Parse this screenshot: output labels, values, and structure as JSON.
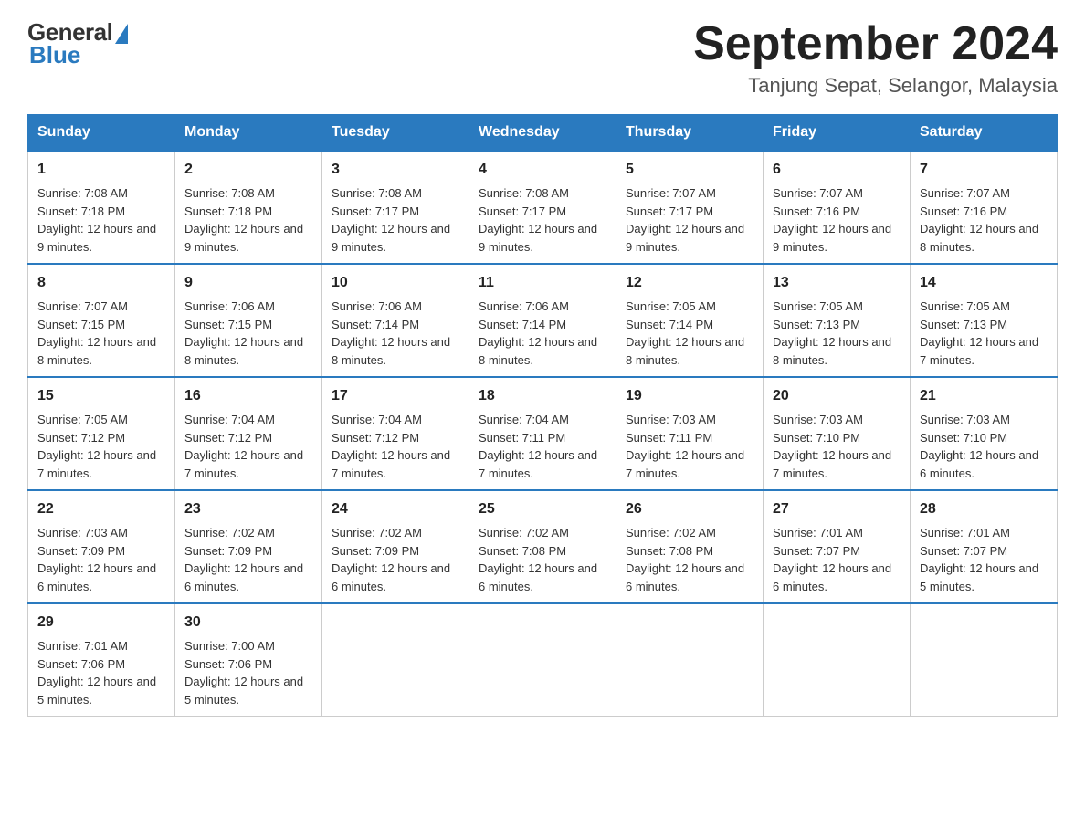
{
  "header": {
    "logo": {
      "general": "General",
      "blue": "Blue"
    },
    "title": "September 2024",
    "location": "Tanjung Sepat, Selangor, Malaysia"
  },
  "days": [
    "Sunday",
    "Monday",
    "Tuesday",
    "Wednesday",
    "Thursday",
    "Friday",
    "Saturday"
  ],
  "weeks": [
    [
      {
        "day": 1,
        "sunrise": "7:08 AM",
        "sunset": "7:18 PM",
        "daylight": "12 hours and 9 minutes."
      },
      {
        "day": 2,
        "sunrise": "7:08 AM",
        "sunset": "7:18 PM",
        "daylight": "12 hours and 9 minutes."
      },
      {
        "day": 3,
        "sunrise": "7:08 AM",
        "sunset": "7:17 PM",
        "daylight": "12 hours and 9 minutes."
      },
      {
        "day": 4,
        "sunrise": "7:08 AM",
        "sunset": "7:17 PM",
        "daylight": "12 hours and 9 minutes."
      },
      {
        "day": 5,
        "sunrise": "7:07 AM",
        "sunset": "7:17 PM",
        "daylight": "12 hours and 9 minutes."
      },
      {
        "day": 6,
        "sunrise": "7:07 AM",
        "sunset": "7:16 PM",
        "daylight": "12 hours and 9 minutes."
      },
      {
        "day": 7,
        "sunrise": "7:07 AM",
        "sunset": "7:16 PM",
        "daylight": "12 hours and 8 minutes."
      }
    ],
    [
      {
        "day": 8,
        "sunrise": "7:07 AM",
        "sunset": "7:15 PM",
        "daylight": "12 hours and 8 minutes."
      },
      {
        "day": 9,
        "sunrise": "7:06 AM",
        "sunset": "7:15 PM",
        "daylight": "12 hours and 8 minutes."
      },
      {
        "day": 10,
        "sunrise": "7:06 AM",
        "sunset": "7:14 PM",
        "daylight": "12 hours and 8 minutes."
      },
      {
        "day": 11,
        "sunrise": "7:06 AM",
        "sunset": "7:14 PM",
        "daylight": "12 hours and 8 minutes."
      },
      {
        "day": 12,
        "sunrise": "7:05 AM",
        "sunset": "7:14 PM",
        "daylight": "12 hours and 8 minutes."
      },
      {
        "day": 13,
        "sunrise": "7:05 AM",
        "sunset": "7:13 PM",
        "daylight": "12 hours and 8 minutes."
      },
      {
        "day": 14,
        "sunrise": "7:05 AM",
        "sunset": "7:13 PM",
        "daylight": "12 hours and 7 minutes."
      }
    ],
    [
      {
        "day": 15,
        "sunrise": "7:05 AM",
        "sunset": "7:12 PM",
        "daylight": "12 hours and 7 minutes."
      },
      {
        "day": 16,
        "sunrise": "7:04 AM",
        "sunset": "7:12 PM",
        "daylight": "12 hours and 7 minutes."
      },
      {
        "day": 17,
        "sunrise": "7:04 AM",
        "sunset": "7:12 PM",
        "daylight": "12 hours and 7 minutes."
      },
      {
        "day": 18,
        "sunrise": "7:04 AM",
        "sunset": "7:11 PM",
        "daylight": "12 hours and 7 minutes."
      },
      {
        "day": 19,
        "sunrise": "7:03 AM",
        "sunset": "7:11 PM",
        "daylight": "12 hours and 7 minutes."
      },
      {
        "day": 20,
        "sunrise": "7:03 AM",
        "sunset": "7:10 PM",
        "daylight": "12 hours and 7 minutes."
      },
      {
        "day": 21,
        "sunrise": "7:03 AM",
        "sunset": "7:10 PM",
        "daylight": "12 hours and 6 minutes."
      }
    ],
    [
      {
        "day": 22,
        "sunrise": "7:03 AM",
        "sunset": "7:09 PM",
        "daylight": "12 hours and 6 minutes."
      },
      {
        "day": 23,
        "sunrise": "7:02 AM",
        "sunset": "7:09 PM",
        "daylight": "12 hours and 6 minutes."
      },
      {
        "day": 24,
        "sunrise": "7:02 AM",
        "sunset": "7:09 PM",
        "daylight": "12 hours and 6 minutes."
      },
      {
        "day": 25,
        "sunrise": "7:02 AM",
        "sunset": "7:08 PM",
        "daylight": "12 hours and 6 minutes."
      },
      {
        "day": 26,
        "sunrise": "7:02 AM",
        "sunset": "7:08 PM",
        "daylight": "12 hours and 6 minutes."
      },
      {
        "day": 27,
        "sunrise": "7:01 AM",
        "sunset": "7:07 PM",
        "daylight": "12 hours and 6 minutes."
      },
      {
        "day": 28,
        "sunrise": "7:01 AM",
        "sunset": "7:07 PM",
        "daylight": "12 hours and 5 minutes."
      }
    ],
    [
      {
        "day": 29,
        "sunrise": "7:01 AM",
        "sunset": "7:06 PM",
        "daylight": "12 hours and 5 minutes."
      },
      {
        "day": 30,
        "sunrise": "7:00 AM",
        "sunset": "7:06 PM",
        "daylight": "12 hours and 5 minutes."
      },
      null,
      null,
      null,
      null,
      null
    ]
  ]
}
